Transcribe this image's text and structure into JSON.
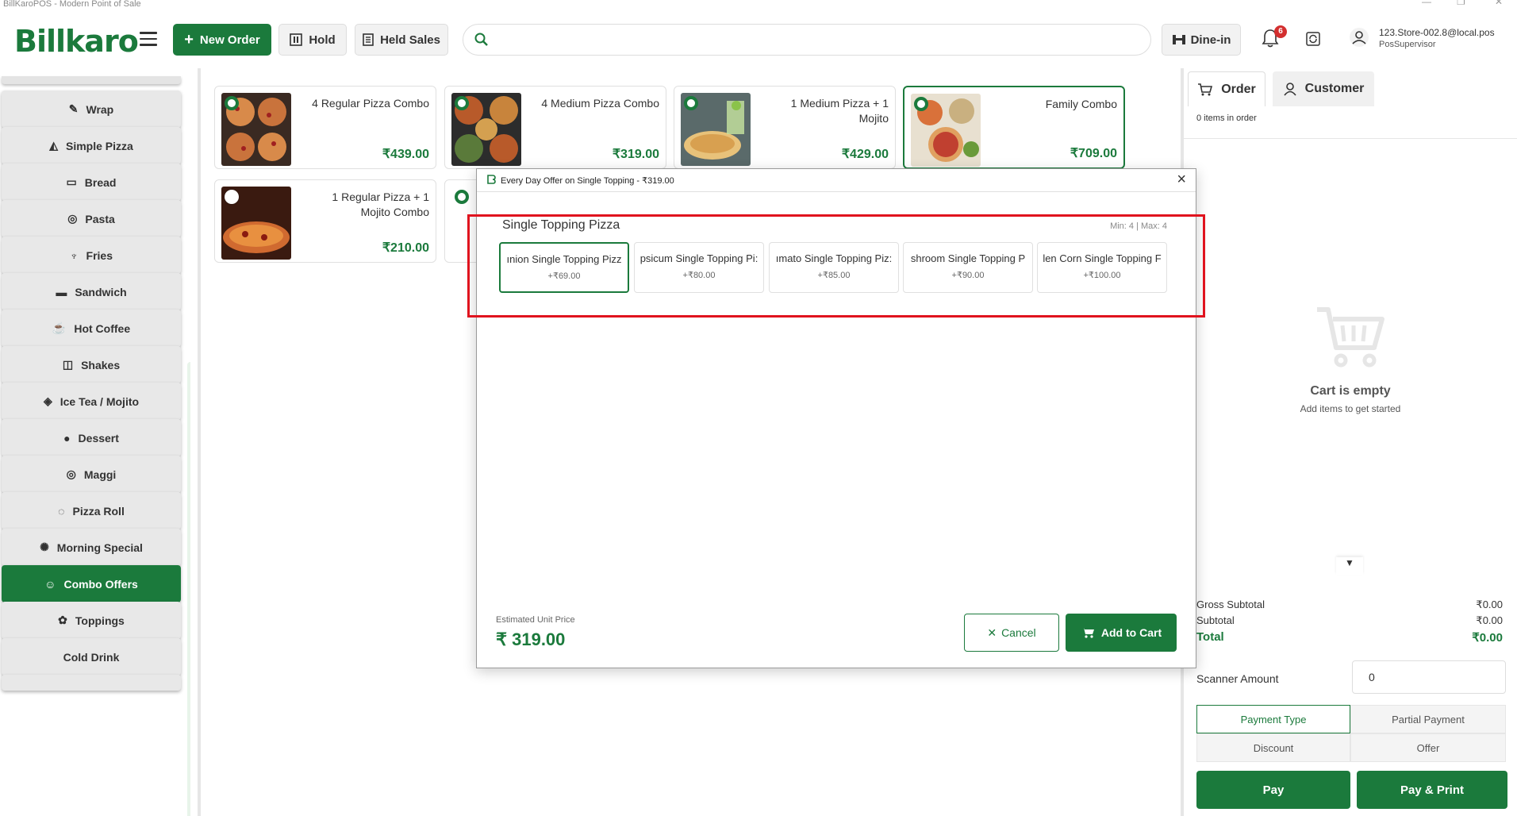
{
  "window": {
    "title": "BillKaroPOS - Modern Point of Sale"
  },
  "header": {
    "logo_text": "Billkaro",
    "new_order": "New Order",
    "hold": "Hold",
    "held_sales": "Held Sales",
    "search_placeholder": "",
    "dine_in": "Dine-in",
    "notification_count": "6",
    "user_email": "123.Store-002.8@local.pos",
    "user_role": "PosSupervisor"
  },
  "sidebar": {
    "categories": [
      {
        "label": "Wrap",
        "icon": "wrap-icon"
      },
      {
        "label": "Simple Pizza",
        "icon": "pizza-icon"
      },
      {
        "label": "Bread",
        "icon": "bread-icon"
      },
      {
        "label": "Pasta",
        "icon": "pasta-icon"
      },
      {
        "label": "Fries",
        "icon": "fries-icon"
      },
      {
        "label": "Sandwich",
        "icon": "sandwich-icon"
      },
      {
        "label": "Hot Coffee",
        "icon": "coffee-icon"
      },
      {
        "label": "Shakes",
        "icon": "shake-icon"
      },
      {
        "label": "Ice Tea / Mojito",
        "icon": "drink-icon"
      },
      {
        "label": "Dessert",
        "icon": "dessert-icon"
      },
      {
        "label": "Maggi",
        "icon": "noodles-icon"
      },
      {
        "label": "Pizza Roll",
        "icon": "pizza-roll-icon"
      },
      {
        "label": "Morning Special",
        "icon": "sun-icon"
      },
      {
        "label": "Combo Offers",
        "icon": "combo-icon",
        "active": true
      },
      {
        "label": "Toppings",
        "icon": "toppings-icon"
      },
      {
        "label": "Cold Drink",
        "icon": ""
      }
    ]
  },
  "products": [
    {
      "name": "4 Regular Pizza Combo",
      "price": "₹439.00"
    },
    {
      "name": "4 Medium Pizza Combo",
      "price": "₹319.00"
    },
    {
      "name": "1 Medium Pizza + 1 Mojito",
      "price": "₹429.00"
    },
    {
      "name": "Family Combo",
      "price": "₹709.00"
    },
    {
      "name": "1 Regular Pizza + 1 Mojito Combo",
      "price": "₹210.00"
    }
  ],
  "right_panel": {
    "tab_order": "Order",
    "tab_customer": "Customer",
    "items_in_order": "0 items in order",
    "cart_empty": "Cart is empty",
    "cart_empty_sub": "Add items to get started",
    "collapse_arrow": "▼",
    "gross_subtotal_label": "Gross Subtotal",
    "gross_subtotal_value": "₹0.00",
    "subtotal_label": "Subtotal",
    "subtotal_value": "₹0.00",
    "total_label": "Total",
    "total_value": "₹0.00",
    "scanner_label": "Scanner Amount",
    "scanner_value": "0",
    "payment_type": "Payment Type",
    "partial_payment": "Partial Payment",
    "discount": "Discount",
    "offer": "Offer",
    "pay": "Pay",
    "pay_print": "Pay & Print"
  },
  "modal": {
    "title": "Every Day Offer on Single Topping - ₹319.00",
    "group_title": "Single Topping Pizza",
    "min_max": "Min: 4 | Max: 4",
    "options": [
      {
        "name": "ınion Single Topping Pizz",
        "price": "+₹69.00",
        "selected": true
      },
      {
        "name": "psicum Single Topping Pi:",
        "price": "+₹80.00"
      },
      {
        "name": "ımato Single Topping Piz:",
        "price": "+₹85.00"
      },
      {
        "name": "shroom Single Topping P",
        "price": "+₹90.00"
      },
      {
        "name": "len Corn Single Topping F",
        "price": "+₹100.00"
      }
    ],
    "est_label": "Estimated Unit Price",
    "est_price": "₹ 319.00",
    "cancel": "Cancel",
    "add_to_cart": "Add to Cart"
  },
  "colors": {
    "brand": "#1b7a3c",
    "highlight": "#e0131e",
    "badge": "#d32f2f"
  }
}
